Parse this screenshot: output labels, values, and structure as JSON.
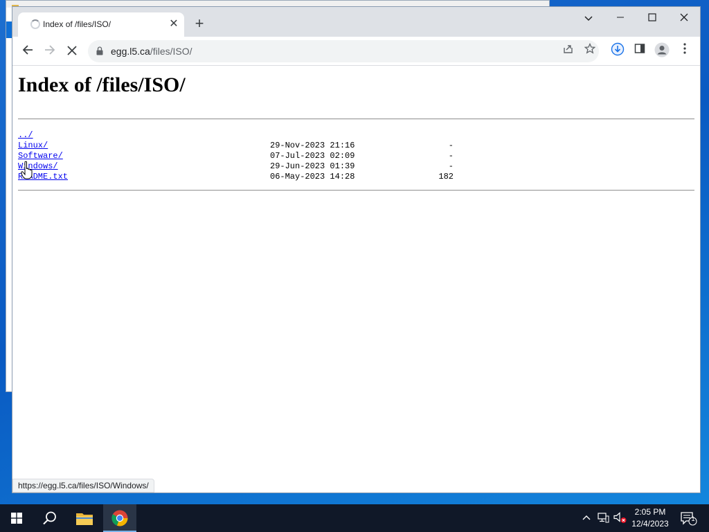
{
  "browser": {
    "tab_title": "Index of /files/ISO/",
    "new_tab_label": "+",
    "url_host": "egg.l5.ca",
    "url_path": "/files/ISO/",
    "status_url": "https://egg.l5.ca/files/ISO/Windows/"
  },
  "page": {
    "heading": "Index of /files/ISO/",
    "entries": [
      {
        "name": "../",
        "date": "",
        "size": ""
      },
      {
        "name": "Linux/",
        "date": "29-Nov-2023 21:16",
        "size": "-"
      },
      {
        "name": "Software/",
        "date": "07-Jul-2023 02:09",
        "size": "-"
      },
      {
        "name": "Windows/",
        "date": "29-Jun-2023 01:39",
        "size": "-"
      },
      {
        "name": "README.txt",
        "date": "06-May-2023 14:28",
        "size": "182"
      }
    ]
  },
  "taskbar": {
    "time": "2:05 PM",
    "date": "12/4/2023",
    "notification_count": "1"
  },
  "colors": {
    "link": "#0000ee",
    "tabstrip": "#dee1e6",
    "taskbar": "#101828",
    "desktop": "#0a5ac2"
  },
  "icons": [
    "back-arrow-icon",
    "forward-arrow-icon",
    "stop-loading-icon",
    "lock-icon",
    "share-icon",
    "star-icon",
    "download-icon",
    "side-panel-icon",
    "profile-icon",
    "menu-kebab-icon",
    "windows-start-icon",
    "search-icon",
    "file-explorer-icon",
    "chrome-icon",
    "chevron-up-icon",
    "network-icon",
    "volume-muted-icon",
    "notification-icon"
  ]
}
